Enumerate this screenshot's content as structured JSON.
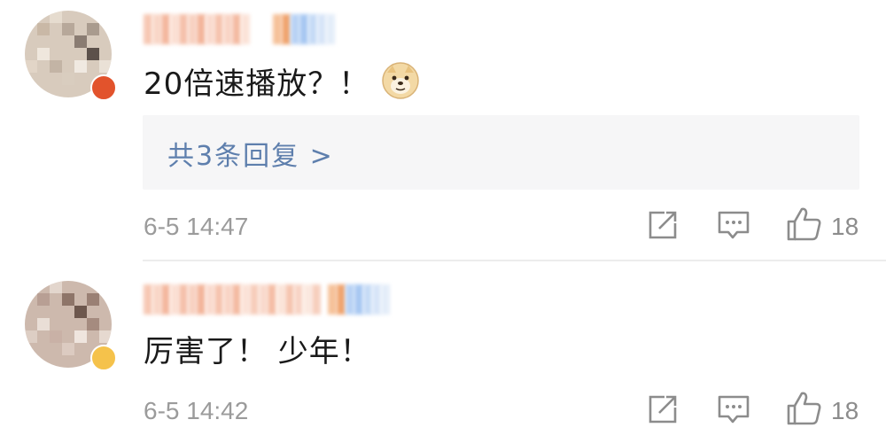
{
  "comments": [
    {
      "text": "20倍速播放？！",
      "emoji": "doge-emoji",
      "reply_summary": "共3条回复 >",
      "time": "6-5 14:47",
      "likes": "18"
    },
    {
      "text": "厉害了！ 少年！",
      "time": "6-5 14:42",
      "likes": "18"
    }
  ],
  "icons": {
    "share": "share-icon",
    "comment": "comment-icon",
    "like": "thumbs-up-icon"
  },
  "colors": {
    "link": "#5e7fad",
    "text": "#1a1a1a",
    "meta": "#9b9b9b",
    "reply_bg": "#f6f6f7",
    "divider": "#ececec"
  }
}
